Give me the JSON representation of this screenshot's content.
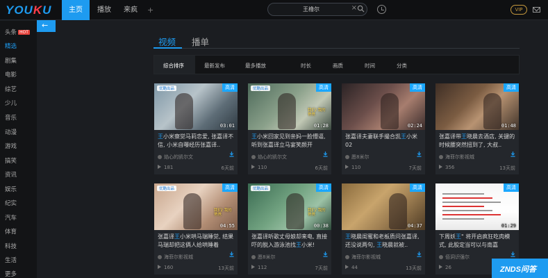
{
  "header": {
    "logo": "YOUKU",
    "nav": [
      "主页",
      "播放",
      "来疯"
    ],
    "plus": "+",
    "search_value": "王橹尔",
    "search_clear": "×",
    "vip": "VIP"
  },
  "sidebar": {
    "items": [
      "头条",
      "精选",
      "剧集",
      "电影",
      "综艺",
      "少儿",
      "音乐",
      "动漫",
      "游戏",
      "搞笑",
      "资讯",
      "娱乐",
      "纪实",
      "汽车",
      "体育",
      "科技",
      "生活",
      "更多"
    ],
    "hot_badge": "HOT",
    "active": "精选"
  },
  "tabs": [
    "视频",
    "播单"
  ],
  "filters": [
    "综合排序",
    "最新发布",
    "最多播放",
    "时长",
    "画质",
    "时间",
    "分类"
  ],
  "cards": [
    {
      "title_parts": [
        [
          "王",
          true
        ],
        [
          "小米察觉马莉恋爱, 张嘉译不信, 小米自曝经历张嘉译..",
          false
        ]
      ],
      "author": "焰心的凯尔文",
      "plays": "181",
      "age": "6天前",
      "duration": "03:01",
      "hd": "高清",
      "source": "优酷出品",
      "caption": ""
    },
    {
      "title_parts": [
        [
          "王",
          true
        ],
        [
          "小米回家见到亲妈一脸懵逼, 听到张嘉译立马宴笑颜开",
          false
        ]
      ],
      "author": "焰心的凯尔文",
      "plays": "110",
      "age": "6天前",
      "duration": "01:28",
      "hd": "高清",
      "source": "优酷出品",
      "caption": "我们/ 我的爸爸"
    },
    {
      "title_parts": [
        [
          "张嘉译夫妻联手撮合凯",
          false
        ],
        [
          "王",
          true
        ],
        [
          "小米 02",
          false
        ]
      ],
      "author": "愿8米尔",
      "plays": "110",
      "age": "7天前",
      "duration": "02:24",
      "hd": "高清",
      "source": "",
      "caption": ""
    },
    {
      "title_parts": [
        [
          "张嘉译带",
          false
        ],
        [
          "王",
          true
        ],
        [
          "晓晨去酒店, 关键的时候腰突然扭到了, 大叔..",
          false
        ]
      ],
      "author": "海菲尔影视城",
      "plays": "356",
      "age": "13天前",
      "duration": "01:48",
      "hd": "高清",
      "source": "",
      "caption": ""
    },
    {
      "title_parts": [
        [
          "张嘉译",
          false
        ],
        [
          "王",
          true
        ],
        [
          "小米哄马瑞睡觉, 结果马瑞却把这俩人给哄睡着",
          false
        ]
      ],
      "author": "海菲尔影视城",
      "plays": "160",
      "age": "13天前",
      "duration": "04:55",
      "hd": "高清",
      "source": "优酷出品",
      "caption": "我们/ 我的爸爸"
    },
    {
      "title_parts": [
        [
          "张嘉译听歌丈母娘却来电, 直接吓的脱入游泳池找",
          false
        ],
        [
          "王",
          true
        ],
        [
          "小米!",
          false
        ]
      ],
      "author": "愿8米尔",
      "plays": "112",
      "age": "7天前",
      "duration": "00:38",
      "hd": "高清",
      "source": "优酷出品",
      "caption": "我们/ 我的爸爸"
    },
    {
      "title_parts": [
        [
          "王",
          true
        ],
        [
          "晓晨闺蜜和老板质问张嘉译, 还没说两句, ",
          false
        ],
        [
          "王",
          true
        ],
        [
          "晓晨就被..",
          false
        ]
      ],
      "author": "海菲尔影视城",
      "plays": "44",
      "age": "13天前",
      "duration": "04:37",
      "hd": "高清",
      "source": "",
      "caption": ""
    },
    {
      "title_parts": [
        [
          "下周妖",
          false
        ],
        [
          "王",
          true
        ],
        [
          "\" 将开启疯狂吃肉模式, 此股定当可以与南嘉",
          false
        ]
      ],
      "author": "佰洞识强尔",
      "plays": "26",
      "age": "13天前",
      "duration": "01:29",
      "hd": "高清",
      "source": "",
      "caption": ""
    }
  ],
  "watermark": "ZNDS问答"
}
